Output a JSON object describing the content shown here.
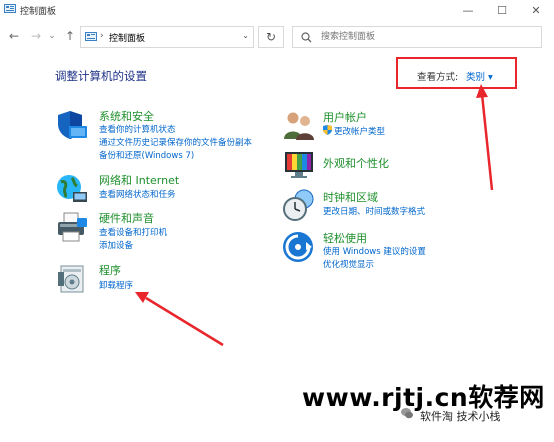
{
  "window": {
    "title": "控制面板",
    "minimize_glyph": "—",
    "maximize_glyph": "☐",
    "close_glyph": "✕"
  },
  "nav": {
    "back_glyph": "←",
    "forward_glyph": "→",
    "dropdown_glyph": "⌄",
    "up_glyph": "↑",
    "breadcrumb_separator": "›",
    "breadcrumb": "控制面板",
    "breadcrumb_dropdown_glyph": "⌄",
    "refresh_glyph": "↻",
    "search_placeholder": "搜索控制面板"
  },
  "main": {
    "heading": "调整计算机的设置",
    "view_by_label": "查看方式:",
    "view_by_value": "类别 ▾"
  },
  "categories_left": [
    {
      "icon": "security-shield-icon",
      "title": "系统和安全",
      "links": [
        "查看你的计算机状态",
        "通过文件历史记录保存你的文件备份副本",
        "备份和还原(Windows 7)"
      ]
    },
    {
      "icon": "network-globe-icon",
      "title": "网络和 Internet",
      "links": [
        "查看网络状态和任务"
      ]
    },
    {
      "icon": "printer-icon",
      "title": "硬件和声音",
      "links": [
        "查看设备和打印机",
        "添加设备"
      ]
    },
    {
      "icon": "programs-icon",
      "title": "程序",
      "links": [
        "卸载程序"
      ]
    }
  ],
  "categories_right": [
    {
      "icon": "user-accounts-icon",
      "title": "用户帐户",
      "links": [
        "更改帐户类型"
      ]
    },
    {
      "icon": "appearance-icon",
      "title": "外观和个性化",
      "links": []
    },
    {
      "icon": "clock-globe-icon",
      "title": "时钟和区域",
      "links": [
        "更改日期、时间或数字格式"
      ]
    },
    {
      "icon": "ease-of-access-icon",
      "title": "轻松使用",
      "links": [
        "使用 Windows 建议的设置",
        "优化视觉显示"
      ]
    }
  ],
  "watermark": {
    "main": "www.rjtj.cn软荐网",
    "sub": "软件淘 技术小栈"
  },
  "colors": {
    "heading": "#1e3287",
    "category_title": "#1e8f2c",
    "link": "#0066cc",
    "annotation": "#e8262c"
  }
}
